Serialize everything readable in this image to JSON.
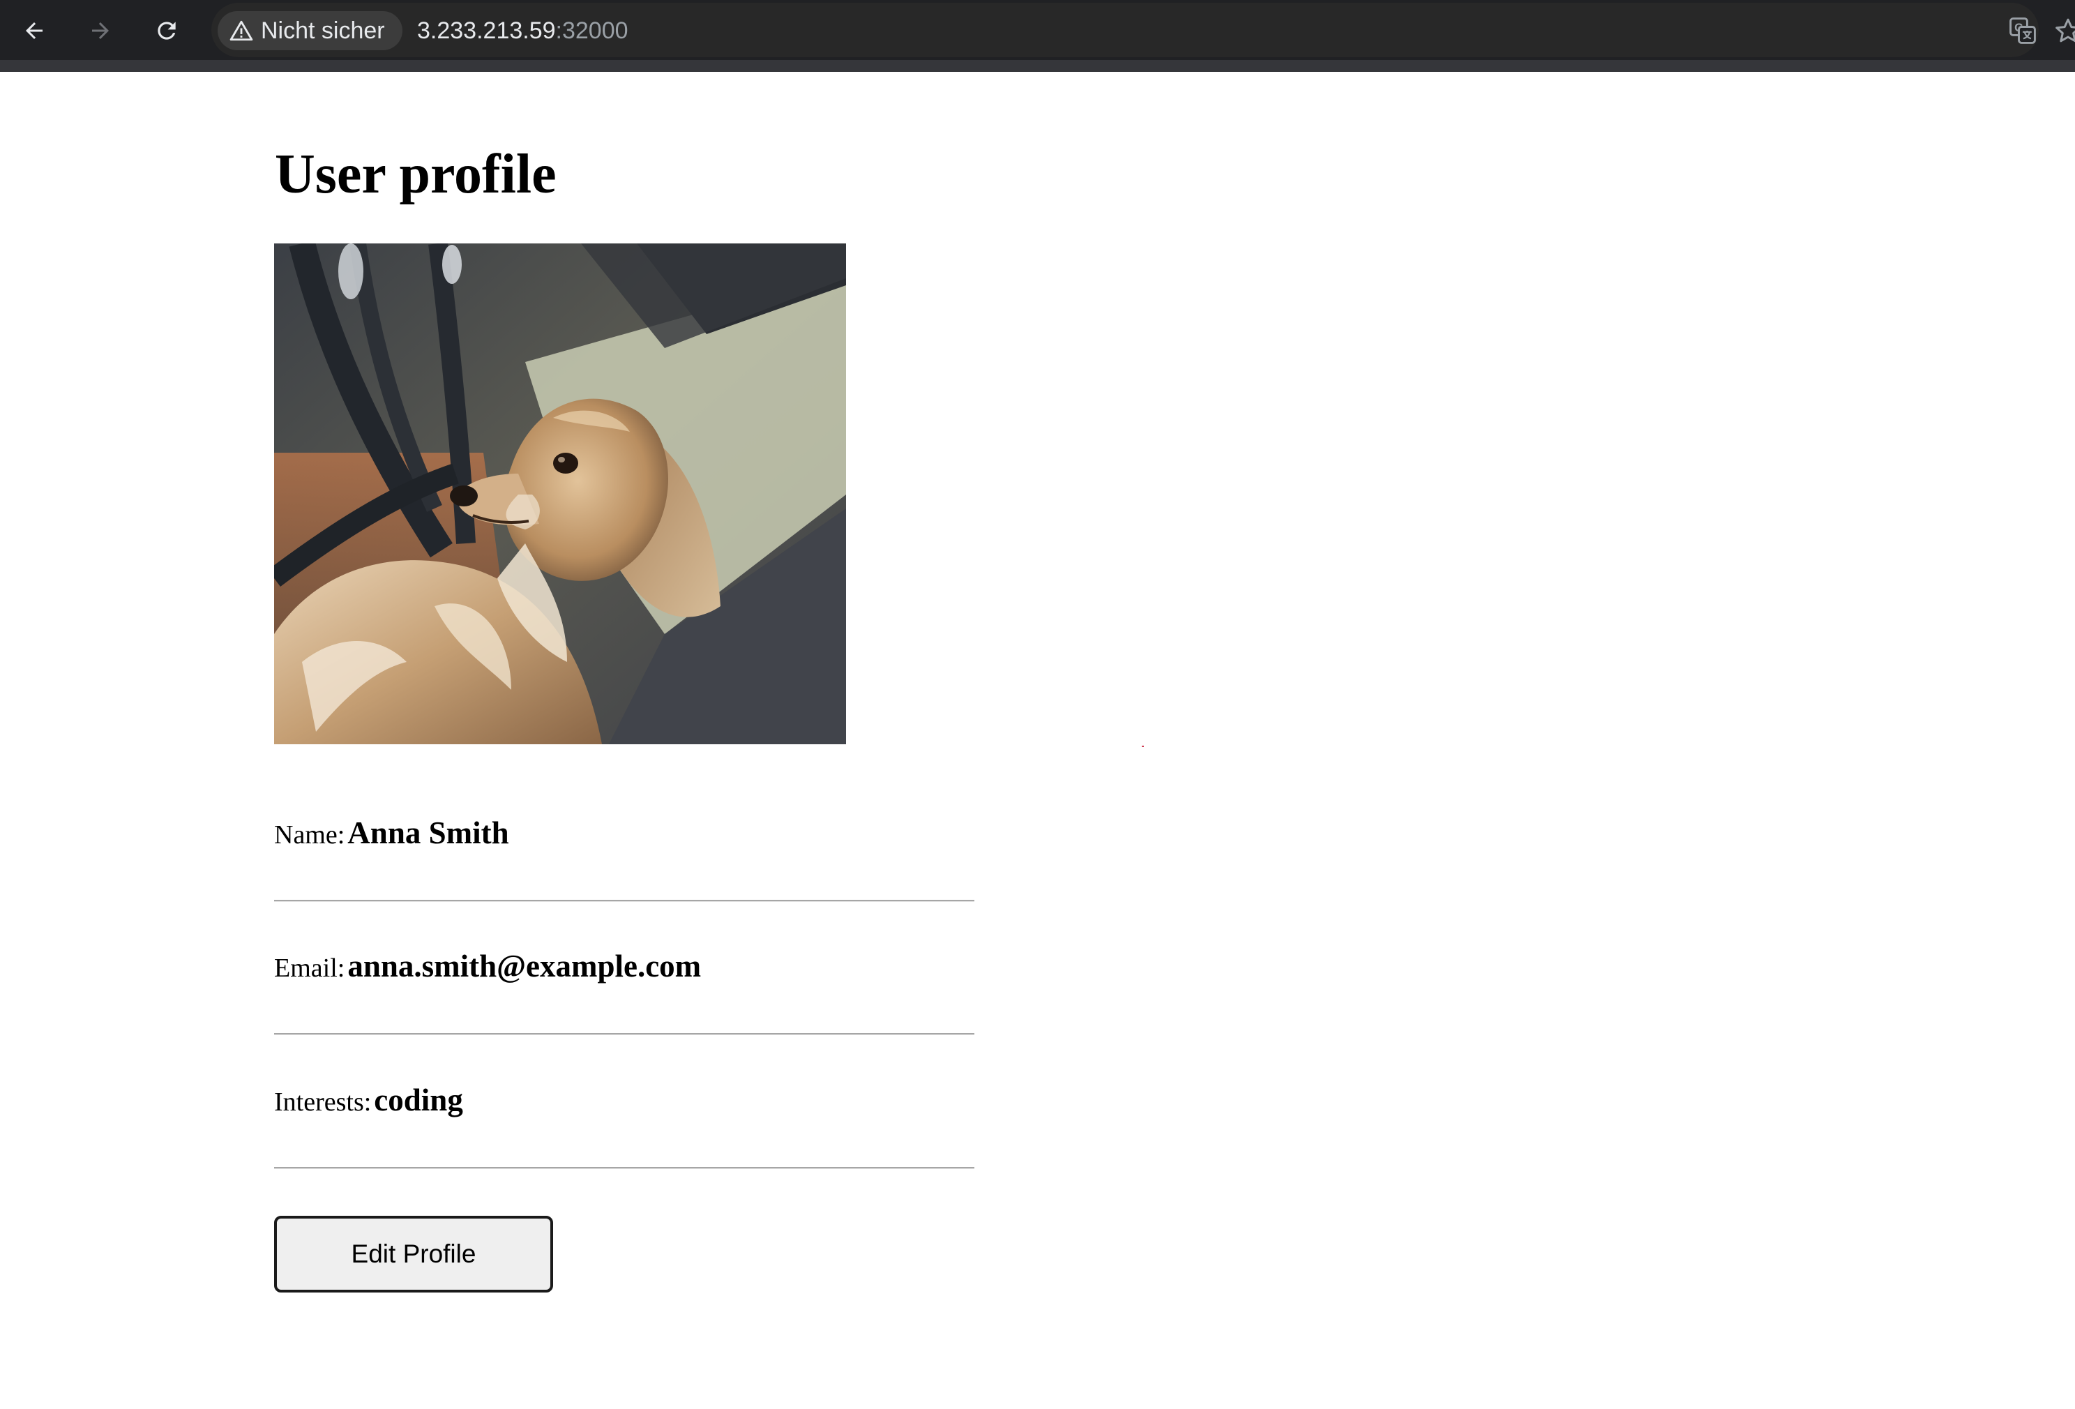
{
  "browser": {
    "security_label": "Nicht sicher",
    "url_host": "3.233.213.59",
    "url_port": ":32000",
    "icons": {
      "back": "arrow-left-icon",
      "forward": "arrow-right-icon",
      "reload": "reload-icon",
      "security": "warning-triangle-icon",
      "translate": "translate-icon",
      "bookmark": "star-icon"
    }
  },
  "page": {
    "title": "User profile",
    "photo_subject": "dog",
    "fields": [
      {
        "label": "Name:",
        "value": "Anna Smith"
      },
      {
        "label": "Email:",
        "value": "anna.smith@example.com"
      },
      {
        "label": "Interests:",
        "value": "coding"
      }
    ],
    "edit_button_label": "Edit Profile"
  },
  "colors": {
    "chrome_background": "#202124",
    "omnibox_background": "#282828",
    "page_background": "#ffffff",
    "button_background": "#efefef"
  }
}
